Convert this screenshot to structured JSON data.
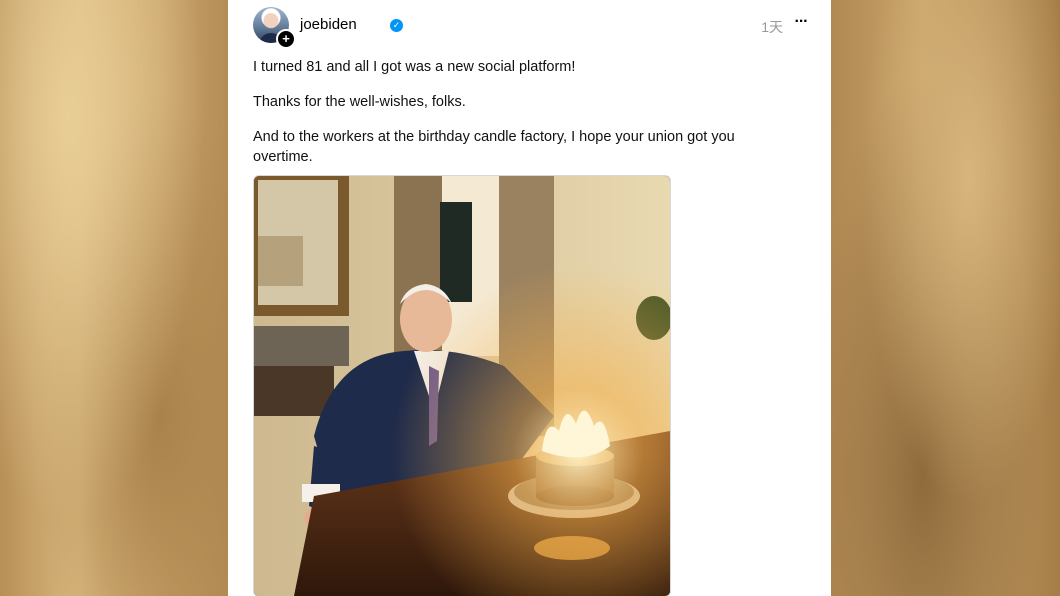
{
  "post": {
    "username": "joebiden",
    "verified_icon": "verified-badge-icon",
    "timestamp": "1天",
    "more_label": "···",
    "avatar_icon": "avatar-image",
    "follow_icon": "plus-icon",
    "paragraphs": [
      "I turned 81 and all I got was a new social platform!",
      "Thanks for the well-wishes, folks.",
      "And to the workers at the birthday candle factory, I hope your union got you overtime."
    ],
    "photo_description_icon": "birthday-cake-photo"
  },
  "colors": {
    "verified": "#0095f6",
    "timestamp": "#999999",
    "text": "#111111",
    "background_blur": "#c9a56a"
  }
}
